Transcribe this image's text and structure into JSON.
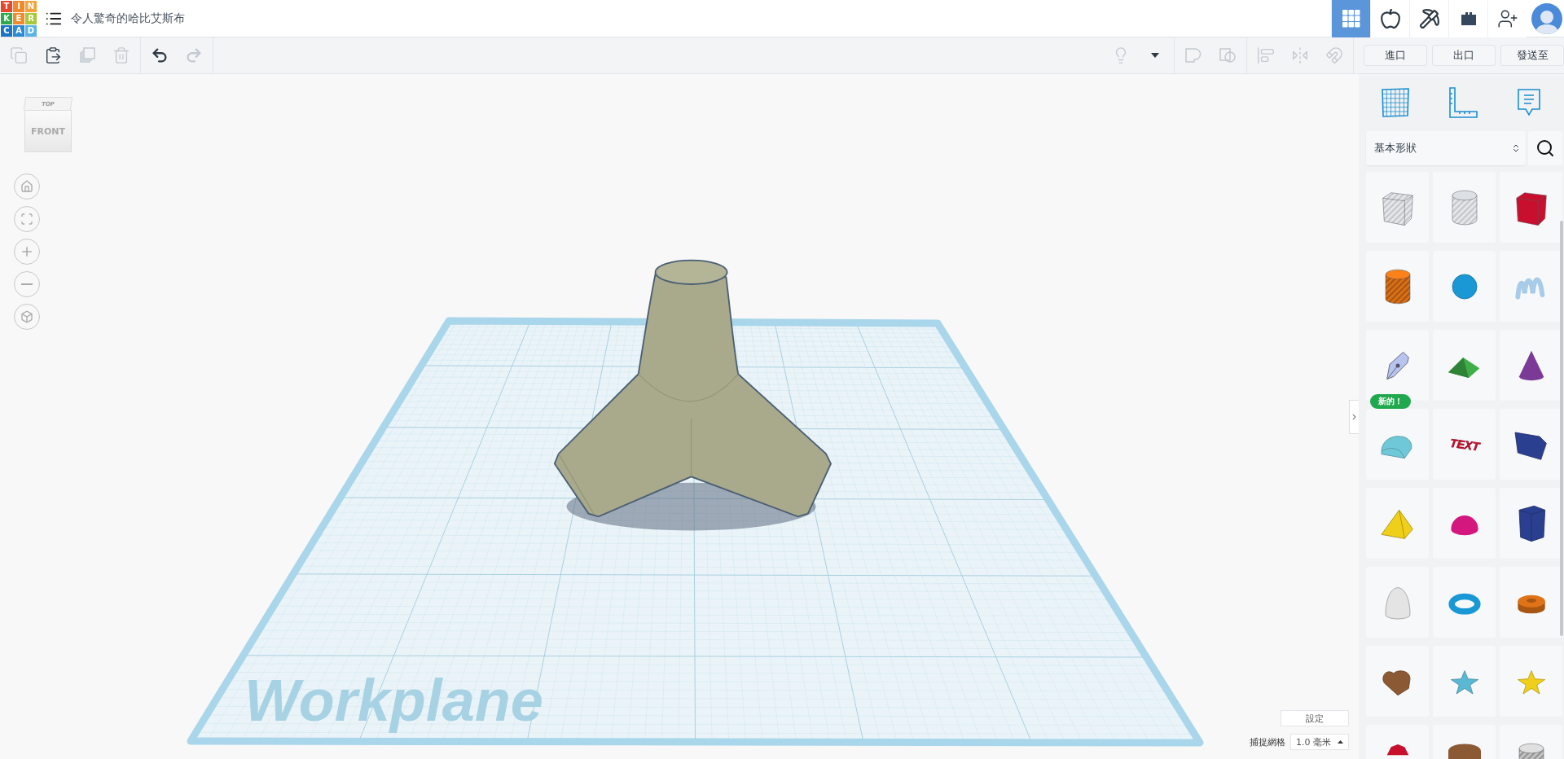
{
  "header": {
    "logo_letters": [
      "T",
      "I",
      "N",
      "K",
      "E",
      "R",
      "C",
      "A",
      "D"
    ],
    "title": "令人驚奇的哈比艾斯布",
    "tabs": [
      {
        "kind": "grid",
        "selected": true
      },
      {
        "kind": "apple",
        "selected": false
      },
      {
        "kind": "pickaxe",
        "selected": false
      },
      {
        "kind": "brick",
        "selected": false
      },
      {
        "kind": "add-user",
        "selected": false
      }
    ]
  },
  "toolbar": {
    "left": [
      [
        {
          "kind": "copy",
          "disabled": true
        },
        {
          "kind": "paste",
          "disabled": false
        },
        {
          "kind": "duplicate",
          "disabled": true
        },
        {
          "kind": "delete",
          "disabled": true
        }
      ],
      [
        {
          "kind": "undo",
          "disabled": false
        },
        {
          "kind": "redo",
          "disabled": true
        }
      ]
    ],
    "right": [
      [
        {
          "kind": "note",
          "disabled": true
        },
        {
          "kind": "caret",
          "disabled": false
        }
      ],
      [
        {
          "kind": "group",
          "disabled": true
        },
        {
          "kind": "ungroup",
          "disabled": true
        }
      ],
      [
        {
          "kind": "align",
          "disabled": true
        },
        {
          "kind": "mirror",
          "disabled": true
        },
        {
          "kind": "magnet",
          "disabled": true
        }
      ]
    ],
    "buttons": [
      "進口",
      "出口",
      "發送至"
    ]
  },
  "view_cube": {
    "top": "TOP",
    "front": "FRONT"
  },
  "workplane": {
    "label": "Workplane"
  },
  "settings_button": "設定",
  "snap_grid": {
    "label": "捕捉網格",
    "value": "1.0 毫米"
  },
  "panel": {
    "tools": [
      {
        "kind": "workplane"
      },
      {
        "kind": "ruler"
      },
      {
        "kind": "notes"
      }
    ],
    "category": "基本形狀",
    "shapes": [
      {
        "kind": "box-hole",
        "color": "#c5c8cc"
      },
      {
        "kind": "cylinder-hole",
        "color": "#c5c8cc"
      },
      {
        "kind": "box",
        "color": "#c8102e"
      },
      {
        "kind": "cylinder",
        "color": "#e07317"
      },
      {
        "kind": "sphere",
        "color": "#1a98d5"
      },
      {
        "kind": "scribble",
        "color": "#a8cbe8"
      },
      {
        "kind": "pen",
        "color": "#b8c4f0",
        "badge": "新的！"
      },
      {
        "kind": "roof",
        "color": "#3fae49"
      },
      {
        "kind": "cone",
        "color": "#7b3a96"
      },
      {
        "kind": "round-roof",
        "color": "#6fc8d8"
      },
      {
        "kind": "text",
        "color": "#c8102e",
        "label": "TEXT"
      },
      {
        "kind": "polygon",
        "color": "#2a3f8f"
      },
      {
        "kind": "pyramid",
        "color": "#f0cf1b"
      },
      {
        "kind": "half-sphere",
        "color": "#d4177f"
      },
      {
        "kind": "prism",
        "color": "#2a3f8f"
      },
      {
        "kind": "paraboloid",
        "color": "#e4e4e4"
      },
      {
        "kind": "torus",
        "color": "#1a98d5"
      },
      {
        "kind": "tube",
        "color": "#e07317"
      },
      {
        "kind": "heart",
        "color": "#8b5a34"
      },
      {
        "kind": "star",
        "color": "#5ab8d5"
      },
      {
        "kind": "star",
        "color": "#f0cf1b"
      },
      {
        "kind": "gem",
        "color": "#c8102e"
      },
      {
        "kind": "dome",
        "color": "#8b5a34"
      },
      {
        "kind": "cylinder",
        "color": "#c8c8c8"
      }
    ]
  }
}
